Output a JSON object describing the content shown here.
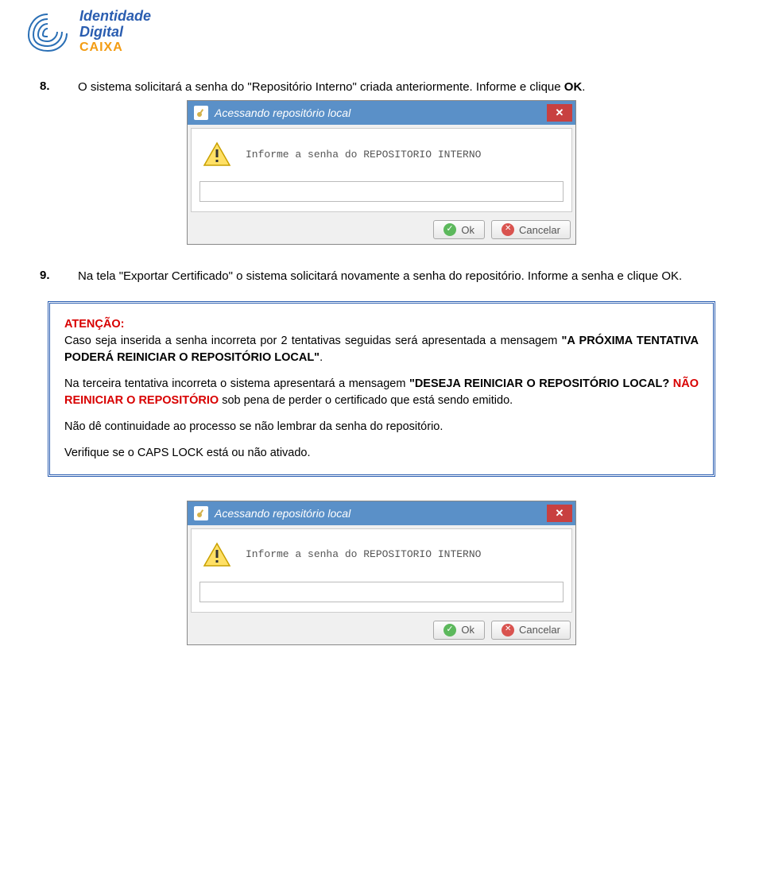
{
  "logo": {
    "line1": "Identidade",
    "line2": "Digital",
    "line3": "CAIXA"
  },
  "steps": {
    "s8": {
      "num": "8.",
      "text_a": "O sistema solicitará a senha do \"Repositório Interno\" criada anteriormente. Informe e clique ",
      "text_b": "OK",
      "text_c": "."
    },
    "s9": {
      "num": "9.",
      "text_a": "Na tela \"Exportar Certificado\" o sistema solicitará novamente a senha do repositório. Informe a senha e clique OK."
    }
  },
  "dialog": {
    "title": "Acessando repositório local",
    "close": "✕",
    "prompt": "Informe a senha do REPOSITORIO INTERNO",
    "input_value": "",
    "ok_label": "Ok",
    "cancel_label": "Cancelar"
  },
  "attention": {
    "title": "ATENÇÃO:",
    "p1_a": "Caso seja inserida a senha incorreta por 2 tentativas seguidas será apresentada a mensagem ",
    "p1_b": "\"A PRÓXIMA TENTATIVA PODERÁ REINICIAR O REPOSITÓRIO LOCAL\"",
    "p1_c": ".",
    "p2_a": "Na terceira tentativa incorreta o sistema apresentará a mensagem ",
    "p2_b": "\"DESEJA REINICIAR O REPOSITÓRIO LOCAL?",
    "p2_c": " NÃO REINICIAR O REPOSITÓRIO",
    "p2_d": " sob pena de perder o certificado que está sendo emitido.",
    "p3": "Não dê continuidade ao processo se não lembrar da senha do repositório.",
    "p4": "Verifique se o CAPS LOCK está ou não ativado."
  }
}
